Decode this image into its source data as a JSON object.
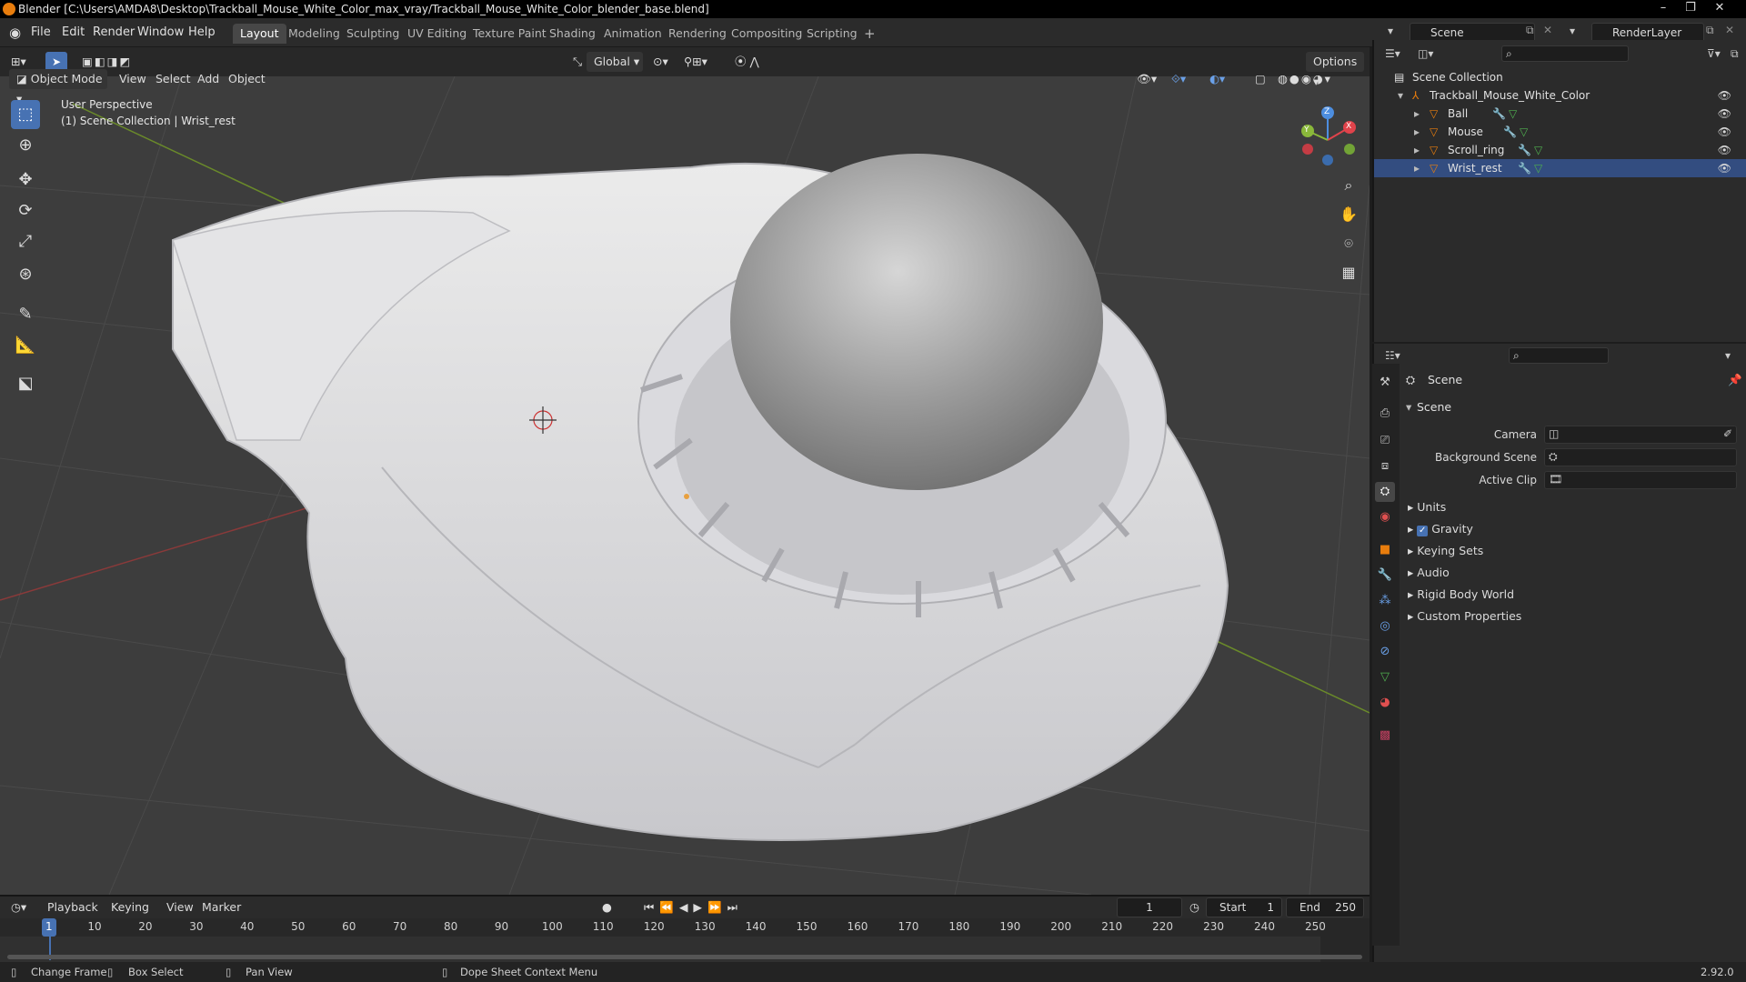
{
  "window": {
    "title": "Blender [C:\\Users\\AMDA8\\Desktop\\Trackball_Mouse_White_Color_max_vray/Trackball_Mouse_White_Color_blender_base.blend]"
  },
  "menu": [
    "File",
    "Edit",
    "Render",
    "Window",
    "Help"
  ],
  "workspaces": [
    "Layout",
    "Modeling",
    "Sculpting",
    "UV Editing",
    "Texture Paint",
    "Shading",
    "Animation",
    "Rendering",
    "Compositing",
    "Scripting",
    "+"
  ],
  "active_workspace": "Layout",
  "scene": {
    "label": "Scene",
    "render_layer": "RenderLayer"
  },
  "tool_header": {
    "transform": "Global",
    "options": "Options"
  },
  "view_header": {
    "mode": "Object Mode",
    "items": [
      "View",
      "Select",
      "Add",
      "Object"
    ]
  },
  "viewport": {
    "overlay_line1": "User Perspective",
    "overlay_line2": "(1) Scene Collection | Wrist_rest",
    "axes": [
      "X",
      "Y",
      "Z"
    ]
  },
  "outliner": {
    "root": "Scene Collection",
    "collection": "Trackball_Mouse_White_Color",
    "objects": [
      "Ball",
      "Mouse",
      "Scroll_ring",
      "Wrist_rest"
    ]
  },
  "properties": {
    "context": "Scene",
    "panel": "Scene",
    "fields": [
      {
        "label": "Camera"
      },
      {
        "label": "Background Scene"
      },
      {
        "label": "Active Clip"
      }
    ],
    "sections": [
      "Units",
      "Gravity",
      "Keying Sets",
      "Audio",
      "Rigid Body World",
      "Custom Properties"
    ],
    "gravity_checked": true
  },
  "timeline": {
    "menus": [
      "Playback",
      "Keying",
      "View",
      "Marker"
    ],
    "current_frame": "1",
    "start_label": "Start",
    "start": "1",
    "end_label": "End",
    "end": "250",
    "ticks": [
      "1",
      "10",
      "20",
      "30",
      "40",
      "50",
      "60",
      "70",
      "80",
      "90",
      "100",
      "110",
      "120",
      "130",
      "140",
      "150",
      "160",
      "170",
      "180",
      "190",
      "200",
      "210",
      "220",
      "230",
      "240",
      "250"
    ]
  },
  "statusbar": {
    "items": [
      "Change Frame",
      "Box Select",
      "Pan View",
      "Dope Sheet Context Menu"
    ],
    "version": "2.92.0"
  },
  "colors": {
    "accent": "#4772b3",
    "orange": "#e87d0d",
    "viewport_bg": "#3d3d3d"
  }
}
